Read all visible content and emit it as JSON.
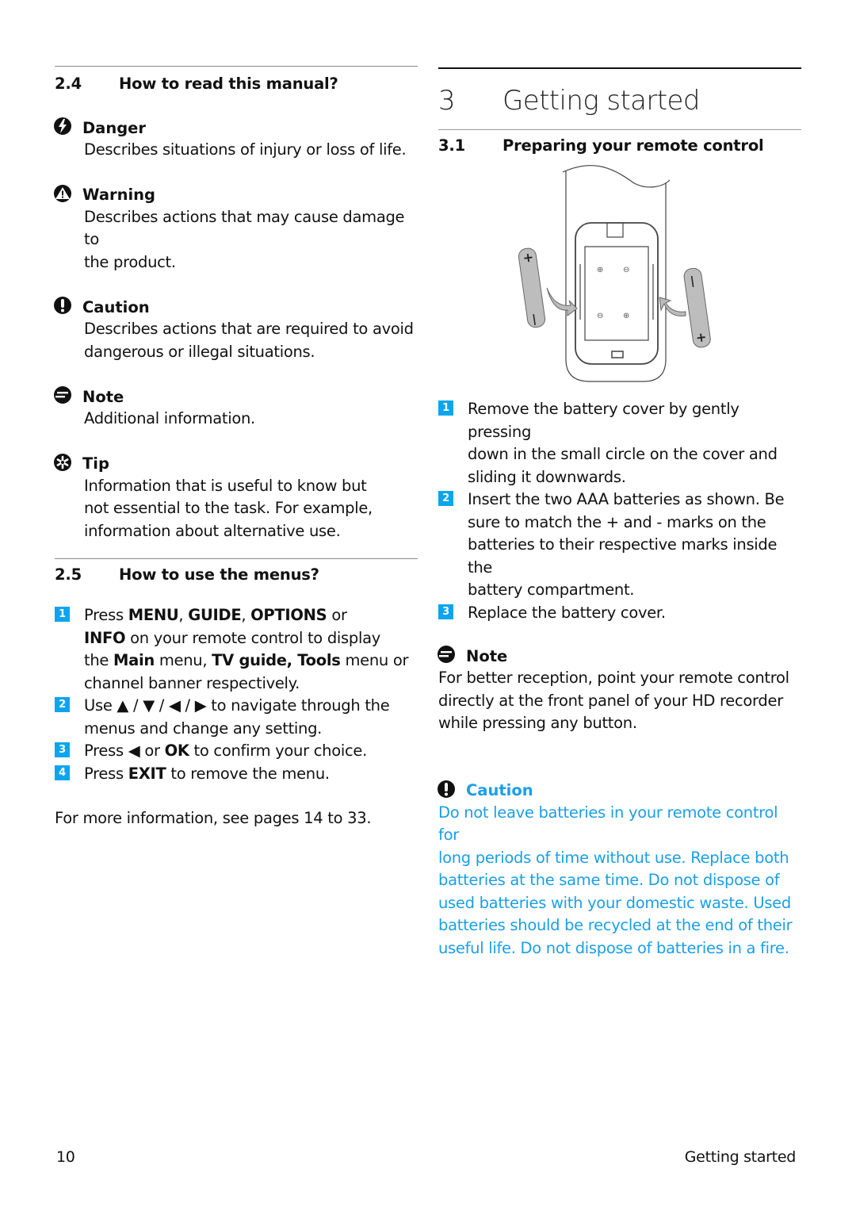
{
  "left": {
    "section_2_4": {
      "number": "2.4",
      "title": "How to read this manual?"
    },
    "callouts": [
      {
        "icon": "danger-bolt-icon",
        "title": "Danger",
        "lines": [
          "Describes situations of injury or loss of life."
        ]
      },
      {
        "icon": "warning-triangle-icon",
        "title": "Warning",
        "lines": [
          "Describes actions that may cause damage to",
          "the product."
        ]
      },
      {
        "icon": "caution-exclamation-icon",
        "title": "Caution",
        "lines": [
          "Describes actions that are required to avoid",
          "dangerous or illegal situations."
        ]
      },
      {
        "icon": "note-lines-icon",
        "title": "Note",
        "lines": [
          "Additional information."
        ]
      },
      {
        "icon": "tip-asterisk-icon",
        "title": "Tip",
        "lines": [
          "Information that is useful to know but",
          "not essential to the task. For example,",
          "information about alternative use."
        ]
      }
    ],
    "section_2_5": {
      "number": "2.5",
      "title": "How to use the menus?"
    },
    "steps": [
      {
        "n": "1",
        "lines": [
          [
            {
              "t": "Press "
            },
            {
              "t": "MENU",
              "b": true
            },
            {
              "t": ", "
            },
            {
              "t": "GUIDE",
              "b": true
            },
            {
              "t": ", "
            },
            {
              "t": "OPTIONS",
              "b": true
            },
            {
              "t": " or"
            }
          ],
          [
            {
              "t": "INFO",
              "b": true
            },
            {
              "t": " on your remote control to display"
            }
          ],
          [
            {
              "t": "the "
            },
            {
              "t": "Main",
              "b": true
            },
            {
              "t": " menu, "
            },
            {
              "t": "TV guide, Tools",
              "b": true
            },
            {
              "t": " menu or"
            }
          ],
          [
            {
              "t": "channel banner respectively."
            }
          ]
        ]
      },
      {
        "n": "2",
        "lines": [
          [
            {
              "t": "Use ▲ / ▼ / ◀ / ▶ to navigate through the"
            }
          ],
          [
            {
              "t": "menus and change any setting."
            }
          ]
        ]
      },
      {
        "n": "3",
        "lines": [
          [
            {
              "t": "Press ◀ or "
            },
            {
              "t": "OK",
              "b": true
            },
            {
              "t": " to confirm your choice."
            }
          ]
        ]
      },
      {
        "n": "4",
        "lines": [
          [
            {
              "t": "Press "
            },
            {
              "t": "EXIT",
              "b": true
            },
            {
              "t": " to remove the menu."
            }
          ]
        ]
      }
    ],
    "more_info": "For more information, see pages 14 to 33."
  },
  "right": {
    "chapter": {
      "number": "3",
      "title": "Getting started"
    },
    "section_3_1": {
      "number": "3.1",
      "title": "Preparing your remote control"
    },
    "illustration": {
      "description": "Remote control battery compartment with two AAA batteries",
      "battery_left_marks": [
        "+",
        "−"
      ],
      "battery_right_marks": [
        "−",
        "+"
      ]
    },
    "steps": [
      {
        "n": "1",
        "lines": [
          [
            {
              "t": "Remove the battery cover by gently pressing"
            }
          ],
          [
            {
              "t": "down in the small circle on the cover and"
            }
          ],
          [
            {
              "t": "sliding it downwards."
            }
          ]
        ]
      },
      {
        "n": "2",
        "lines": [
          [
            {
              "t": "Insert the two AAA batteries as shown. Be"
            }
          ],
          [
            {
              "t": "sure to match the + and - marks on the"
            }
          ],
          [
            {
              "t": "batteries to their respective marks inside the"
            }
          ],
          [
            {
              "t": "battery compartment."
            }
          ]
        ]
      },
      {
        "n": "3",
        "lines": [
          [
            {
              "t": "Replace the battery cover."
            }
          ]
        ]
      }
    ],
    "note": {
      "title": "Note",
      "lines": [
        "For better reception, point your remote control",
        "directly at the front panel of your HD recorder",
        "while pressing any button."
      ]
    },
    "caution": {
      "title": "Caution",
      "color": "#1a9fe6",
      "lines": [
        "Do not leave batteries in your remote control for",
        "long periods of time without use. Replace both",
        "batteries at the same time. Do not dispose of",
        "used batteries with your domestic waste. Used",
        "batteries should be recycled at the end of their",
        "useful life. Do not dispose of batteries in a fire."
      ]
    }
  },
  "footer": {
    "page_number": "10",
    "section_label": "Getting started"
  },
  "colors": {
    "badge": "#0aa5ee",
    "caution_text": "#1a9fe6",
    "text": "#111111"
  }
}
